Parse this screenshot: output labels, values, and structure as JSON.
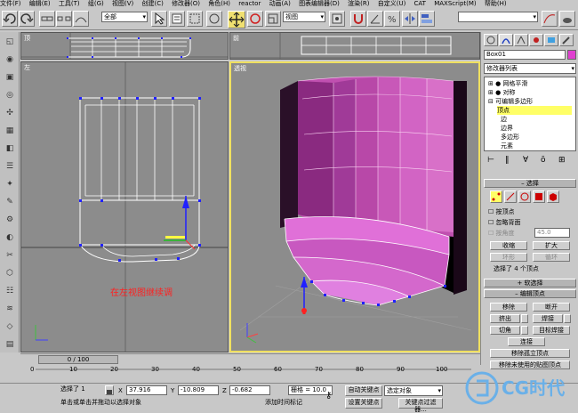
{
  "menu": [
    "文件(F)",
    "编辑(E)",
    "工具(T)",
    "组(G)",
    "视图(V)",
    "创建(C)",
    "修改器(O)",
    "角色(H)",
    "reactor",
    "动画(A)",
    "图表编辑器(D)",
    "渲染(R)",
    "自定义(U)",
    "CAT",
    "MAXScript(M)",
    "帮助(H)"
  ],
  "toolbar": {
    "selection_filter": "全部",
    "coord_system": "视图"
  },
  "viewports": {
    "top": {
      "label": "顶"
    },
    "front": {
      "label": "前"
    },
    "left": {
      "label": "左",
      "annotation": "在左视图继续调"
    },
    "perspective": {
      "label": "透视"
    }
  },
  "colors": {
    "selection_highlight": "#ffff66",
    "object_color": "#e040d0",
    "annotation_red": "#ff2020",
    "vertex_blue": "#1010ff"
  },
  "command_panel": {
    "object_name": "Box01",
    "modifier_list": "修改器列表",
    "stack": [
      {
        "label": "网格平滑",
        "expanded": false
      },
      {
        "label": "对称",
        "expanded": false
      },
      {
        "label": "可编辑多边形",
        "expanded": true
      },
      {
        "label": "顶点",
        "selected": true
      },
      {
        "label": "边"
      },
      {
        "label": "边界"
      },
      {
        "label": "多边形"
      },
      {
        "label": "元素"
      }
    ],
    "selection": {
      "title": "选择",
      "by_vertex": "按顶点",
      "ignore_backfacing": "忽略背面",
      "by_angle": "按角度",
      "angle_value": "45.0",
      "shrink": "收缩",
      "grow": "扩大",
      "ring": "环形",
      "loop": "循环",
      "status": "选择了 4 个顶点"
    },
    "soft_selection": "软选择",
    "edit_vertices": {
      "title": "编辑顶点",
      "remove": "移除",
      "break": "断开",
      "extrude": "挤出",
      "weld": "焊接",
      "chamfer": "切角",
      "target_weld": "目标焊接",
      "connect": "连接",
      "remove_isolated": "移除孤立顶点",
      "remove_unused_map": "移除未使用的贴图顶点"
    }
  },
  "timeline": {
    "frame": "0 / 100",
    "ticks": [
      "0",
      "10",
      "20",
      "30",
      "40",
      "50",
      "60",
      "70",
      "80",
      "90",
      "100"
    ]
  },
  "status_bar": {
    "selected": "选择了 1",
    "x_label": "X",
    "x_value": "37.916",
    "y_label": "Y",
    "y_value": "-10.809",
    "z_label": "Z",
    "z_value": "-0.682",
    "grid": "栅格 = 10.0",
    "auto_key": "自动关键点",
    "set_key": "设置关键点",
    "key_filter": "选定对象",
    "key_filters_btn": "关键点过滤器...",
    "prompt": "单击或单击并拖动以选择对象",
    "add_time_tag": "添加时间标记"
  },
  "watermark": "CG时代"
}
